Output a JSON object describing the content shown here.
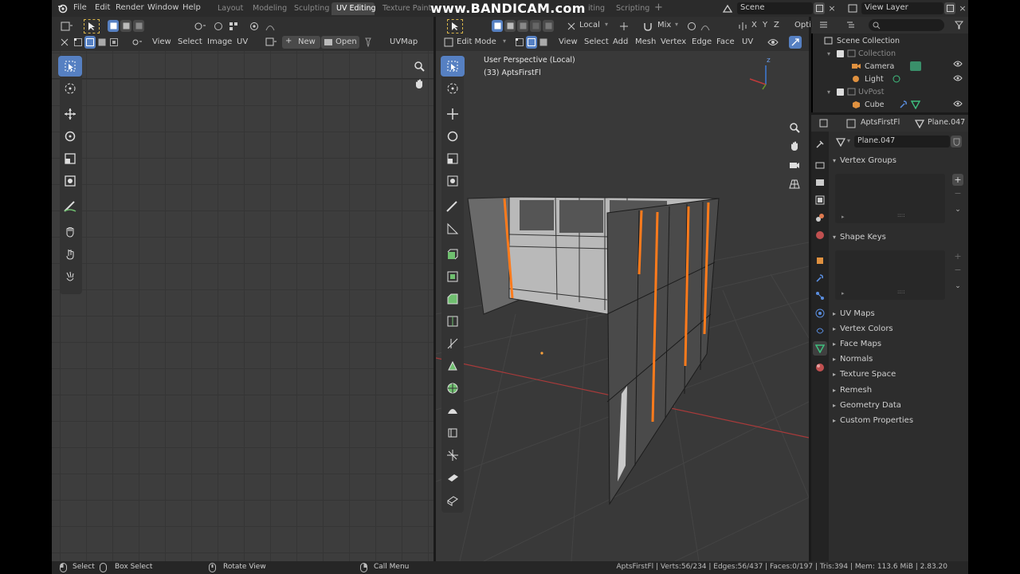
{
  "topbar": {
    "menus": [
      "File",
      "Edit",
      "Render",
      "Window",
      "Help"
    ],
    "workspaces": [
      "Layout",
      "Modeling",
      "Sculpting",
      "UV Editing",
      "Texture Paint",
      "Scripting"
    ],
    "active_workspace": "UV Editing",
    "watermark": "www.BANDICAM.com",
    "watermark_hidden_tab_suffix": "iting",
    "scene": "Scene",
    "view_layer": "View Layer"
  },
  "uv_editor": {
    "menus": [
      "View",
      "Select",
      "Image",
      "UV"
    ],
    "new_label": "New",
    "open_label": "Open",
    "uvmap": "UVMap"
  },
  "viewport": {
    "mode": "Edit Mode",
    "menus": [
      "View",
      "Select",
      "Add",
      "Mesh",
      "Vertex",
      "Edge",
      "Face",
      "UV"
    ],
    "transform_orientation": "Local",
    "proportional": "Mix",
    "options_label": "Opti",
    "overlay_line1": "User Perspective (Local)",
    "overlay_line2": "(33) AptsFirstFl",
    "axis_z": "z"
  },
  "outliner": {
    "root": "Scene Collection",
    "items": [
      {
        "label": "Collection",
        "dim": true
      },
      {
        "label": "Camera",
        "dim": false
      },
      {
        "label": "Light",
        "dim": false
      },
      {
        "label": "UvPost",
        "dim": true
      },
      {
        "label": "Cube",
        "dim": false
      }
    ]
  },
  "properties": {
    "object_name": "AptsFirstFl",
    "mesh_name_header": "Plane.047",
    "mesh_datablock": "Plane.047",
    "sections_open": [
      "Vertex Groups",
      "Shape Keys"
    ],
    "sections_closed": [
      "UV Maps",
      "Vertex Colors",
      "Face Maps",
      "Normals",
      "Texture Space",
      "Remesh",
      "Geometry Data",
      "Custom Properties"
    ]
  },
  "statusbar": {
    "left": [
      "Select",
      "Box Select",
      "Rotate View",
      "Call Menu"
    ],
    "stats": "AptsFirstFl | Verts:56/234 | Edges:56/437 | Faces:0/197 | Tris:394 | Mem: 113.6 MiB | 2.83.20"
  },
  "colors": {
    "accent_blue": "#4772b3",
    "selected_edge": "#ff7b1c",
    "x_axis": "#a83a3a"
  }
}
